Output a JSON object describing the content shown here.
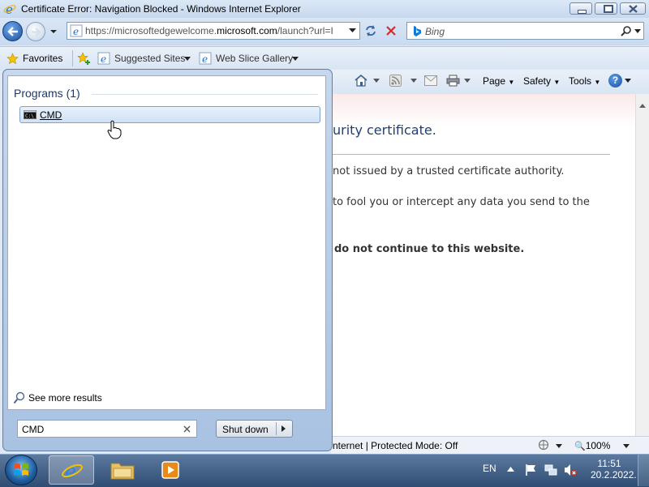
{
  "window": {
    "title": "Certificate Error: Navigation Blocked - Windows Internet Explorer"
  },
  "navbar": {
    "url_prefix": "https://microsoftedgewelcome.",
    "url_domain": "microsoft.com",
    "url_suffix": "/launch?url=I",
    "search_placeholder": "Bing"
  },
  "favorites_bar": {
    "favorites_label": "Favorites",
    "suggested_sites": "Suggested Sites",
    "web_slice_gallery": "Web Slice Gallery"
  },
  "command_bar": {
    "page": "Page",
    "safety": "Safety",
    "tools": "Tools"
  },
  "content": {
    "heading_fragment": "urity certificate.",
    "line1": "not issued by a trusted certificate authority.",
    "line2": "to fool you or intercept any data you send to the",
    "warning": "do not continue to this website."
  },
  "status_bar": {
    "zone": "nternet | Protected Mode: Off",
    "zoom": "100%"
  },
  "start_menu": {
    "programs_header": "Programs (1)",
    "result_label": "CMD",
    "see_more": "See more results",
    "search_value": "CMD",
    "shutdown_label": "Shut down"
  },
  "taskbar": {
    "language": "EN",
    "time": "11:51",
    "date": "20.2.2022."
  }
}
